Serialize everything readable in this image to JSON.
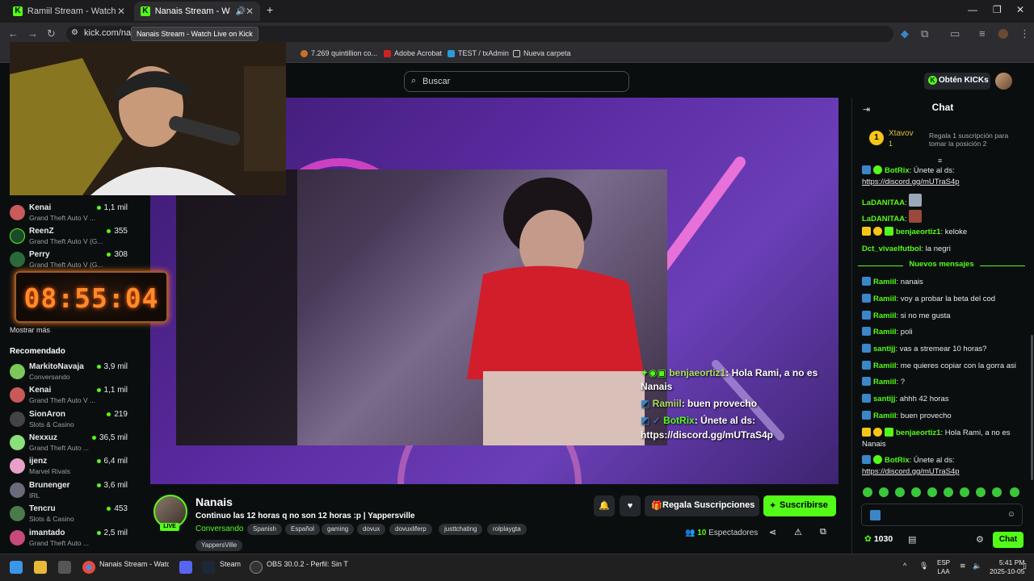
{
  "browser": {
    "tabs": [
      {
        "title": "Ramiil Stream - Watch Live on K"
      },
      {
        "title": "Nanais Stream - Watch Live"
      }
    ],
    "url": "kick.com/nan",
    "tooltip": "Nanais Stream - Watch Live on Kick",
    "bookmarks": [
      "7.269 quintillion co...",
      "Adobe Acrobat",
      "TEST / txAdmin",
      "Nueva carpeta"
    ]
  },
  "site": {
    "search_placeholder": "Buscar",
    "get_kicks": "Obtén KICKs"
  },
  "sidebar": {
    "following": [
      {
        "name": "Kenai",
        "category": "Grand Theft Auto V ...",
        "viewers": "1,1 mil"
      },
      {
        "name": "ReenZ",
        "category": "Grand Theft Auto V (G...",
        "viewers": "355"
      },
      {
        "name": "Perry",
        "category": "Grand Theft Auto V (G...",
        "viewers": "308"
      }
    ],
    "show_more": "Mostrar más",
    "recommended_title": "Recomendado",
    "recommended": [
      {
        "name": "MarkitoNavaja",
        "category": "Conversando",
        "viewers": "3,9 mil"
      },
      {
        "name": "Kenai",
        "category": "Grand Theft Auto V ...",
        "viewers": "1,1 mil"
      },
      {
        "name": "SionAron",
        "category": "Slots & Casino",
        "viewers": "219"
      },
      {
        "name": "Nexxuz",
        "category": "Grand Theft Auto ...",
        "viewers": "36,5 mil"
      },
      {
        "name": "ijenz",
        "category": "Marvel Rivals",
        "viewers": "6,4 mil"
      },
      {
        "name": "Brunenger",
        "category": "IRL",
        "viewers": "3,6 mil"
      },
      {
        "name": "Tencru",
        "category": "Slots & Casino",
        "viewers": "453"
      },
      {
        "name": "imantado",
        "category": "Grand Theft Auto ...",
        "viewers": "2,5 mil"
      }
    ]
  },
  "timer": "08:55:04",
  "video_overlay": {
    "line1_user": "benjaeortiz1",
    "line1_text": ": Hola Rami, a no es",
    "line1_cont": "Nanais",
    "line2_user": "Ramiil",
    "line2_text": ": buen provecho",
    "line3_user": "BotRix",
    "line3_text": ": Únete al ds:",
    "line4_text": "https://discord.gg/mUTraS4p"
  },
  "stream": {
    "streamer": "Nanais",
    "live": "LIVE",
    "title": "Continuo las 12 horas q no son 12 horas :p |  Yappersville",
    "category": "Conversando",
    "tags": [
      "Spanish",
      "Español",
      "gaming",
      "dovux",
      "dovuxliferp",
      "justtchating",
      "rolplaygta",
      "YappersVille"
    ],
    "gift_label": "Regala Suscripciones",
    "subscribe_label": "Suscribirse",
    "viewers_count": "10",
    "viewers_label": "Espectadores"
  },
  "chat": {
    "title": "Chat",
    "pinned": {
      "user": "Xtavov",
      "rank": "1",
      "count": "1",
      "message": "Regala 1 suscripción para tomar la posición 2"
    },
    "messages_before": [
      {
        "user": "BotRix",
        "text": " Únete al ds:",
        "link": "https://discord.gg/mUTraS4p",
        "color": "#53fc18"
      },
      {
        "user": "LaDANITAA",
        "text": "",
        "color": "#53fc18"
      },
      {
        "user": "LaDANITAA",
        "text": "",
        "color": "#53fc18"
      },
      {
        "user": "benjaeortiz1",
        "text": " keloke",
        "color": "#53fc18"
      },
      {
        "user": "Dct_vivaelfutbol",
        "text": " la negri",
        "color": "#53fc18"
      }
    ],
    "new_messages": "Nuevos mensajes",
    "messages_after": [
      {
        "user": "Ramiil",
        "text": " nanais",
        "color": "#53fc18"
      },
      {
        "user": "Ramiil",
        "text": " voy a probar la beta del cod",
        "color": "#53fc18"
      },
      {
        "user": "Ramiil",
        "text": " si no me gusta",
        "color": "#53fc18"
      },
      {
        "user": "Ramiil",
        "text": " poli",
        "color": "#53fc18"
      },
      {
        "user": "santijj",
        "text": " vas a stremear 10 horas?",
        "color": "#53fc18"
      },
      {
        "user": "Ramiil",
        "text": " me quieres copiar con la gorra asi",
        "color": "#53fc18"
      },
      {
        "user": "Ramiil",
        "text": " ?",
        "color": "#53fc18"
      },
      {
        "user": "santijj",
        "text": " ahhh 42 horas",
        "color": "#53fc18"
      },
      {
        "user": "Ramiil",
        "text": " buen provecho",
        "color": "#53fc18"
      },
      {
        "user": "benjaeortiz1",
        "text": " Hola Rami, a no es",
        "cont": "Nanais",
        "color": "#53fc18"
      },
      {
        "user": "BotRix",
        "text": " Únete al ds:",
        "link": "https://discord.gg/mUTraS4p",
        "color": "#53fc18"
      }
    ],
    "points": "1030",
    "chat_button": "Chat"
  },
  "taskbar": {
    "apps": [
      "Nanais Stream - Watch",
      "Steam",
      "OBS 30.0.2 - Perfil: Sin T"
    ],
    "lang": "ESP",
    "lang2": "LAA",
    "time": "5:41 PM",
    "date": "2025-10-05"
  },
  "colors": {
    "accent": "#53fc18",
    "background": "#0b0e0f",
    "video": "#5a2aa0",
    "timer": "#ff8a2a"
  }
}
